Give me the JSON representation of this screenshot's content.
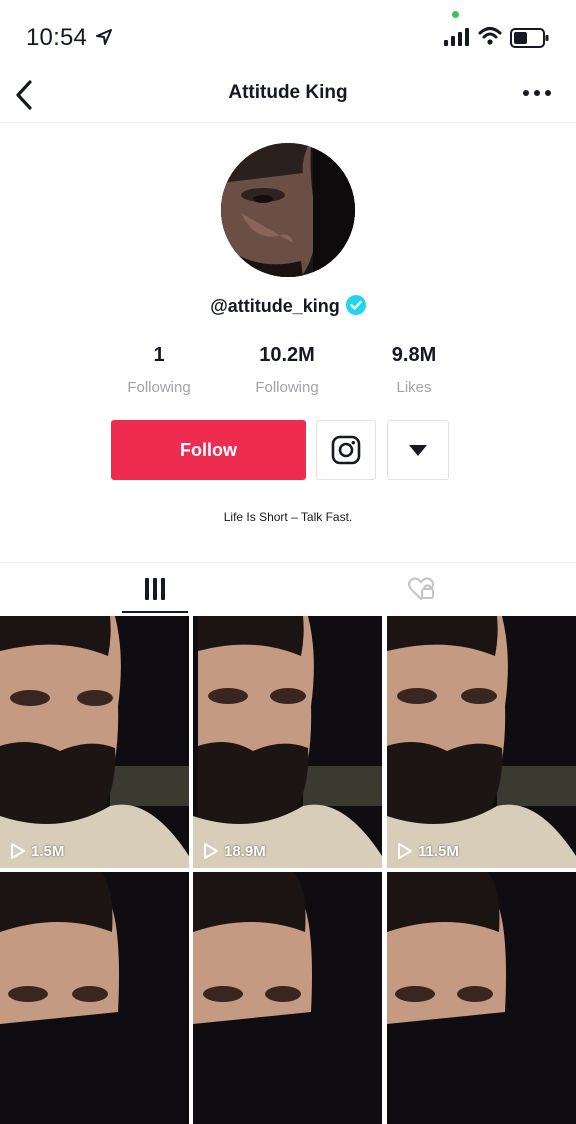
{
  "status_bar": {
    "time": "10:54"
  },
  "nav": {
    "title": "Attitude King"
  },
  "profile": {
    "username": "@attitude_king",
    "stats": [
      {
        "value": "1",
        "label": "Following"
      },
      {
        "value": "10.2M",
        "label": "Following"
      },
      {
        "value": "9.8M",
        "label": "Likes"
      }
    ],
    "follow_label": "Follow",
    "bio": "Life Is Short – Talk Fast."
  },
  "videos": [
    {
      "views": "1.5M"
    },
    {
      "views": "18.9M"
    },
    {
      "views": "11.5M"
    },
    {
      "views": ""
    },
    {
      "views": ""
    },
    {
      "views": ""
    }
  ],
  "colors": {
    "accent": "#ee2c50",
    "verified": "#20d5ec",
    "text": "#161823"
  }
}
